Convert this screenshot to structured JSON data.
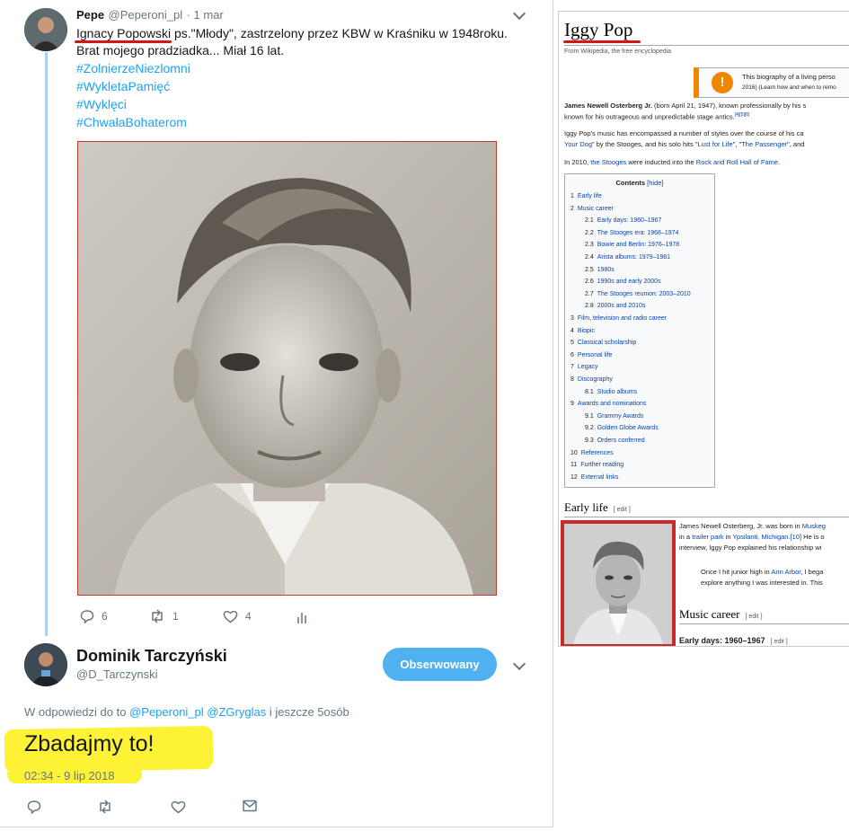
{
  "tweet1": {
    "author_name": "Pepe",
    "author_handle": "@Peperoni_pl",
    "date": "· 1 mar",
    "text_line1_name": "Ignacy Popowski",
    "text_line1_rest": " ps.\"Młody\", zastrzelony przez KBW w Kraśniku w 1948roku.",
    "text_line2": "Brat mojego pradziadka... Miał 16 lat.",
    "hashtags": [
      "#ZolnierzeNiezlomni",
      "#WykletaPamięć",
      "#Wyklęci",
      "#ChwałaBohaterom"
    ],
    "replies": "6",
    "retweets": "1",
    "likes": "4"
  },
  "tweet2": {
    "author_name": "Dominik Tarczyński",
    "author_handle": "@D_Tarczynski",
    "follow_label": "Obserwowany",
    "reply_prefix": "W odpowiedzi do to ",
    "mention1": "@Peperoni_pl",
    "mention2": "@ZGryglas",
    "reply_suffix": " i jeszcze 5osób",
    "text": "Zbadajmy to!",
    "timestamp": "02:34 - 9 lip 2018"
  },
  "wiki": {
    "title": "Iggy Pop",
    "from": "From Wikipedia, the free encyclopedia",
    "notice_line1": "This biography of a living perso",
    "notice_line2": "2016) (Learn how and when to remo",
    "lead1_bold": "James Newell Osterberg Jr.",
    "lead1_rest": " (born April 21, 1947), known professionally by his s",
    "lead2": "known for his outrageous and unpredictable stage antics.",
    "lead2_ref": "[4][5][6]",
    "para2_line1": "Iggy Pop's music has encompassed a number of styles over the course of his ca",
    "para2_line2_link1": "Your Dog",
    "para2_line2_mid": "\" by the Stooges, and his solo hits \"",
    "para2_line2_link2": "Lust for Life",
    "para2_line2_sep": "\", \"",
    "para2_line2_link3": "The Passenger",
    "para2_line2_end": "\", and",
    "para3_pre": "In 2010, ",
    "para3_link1": "the Stooges",
    "para3_mid": " were inducted into the ",
    "para3_link2": "Rock and Roll Hall of Fame",
    "para3_end": ".",
    "toc_title": "Contents",
    "toc_hide": "[hide]",
    "toc": [
      {
        "num": "1",
        "label": "Early life",
        "level": 1
      },
      {
        "num": "2",
        "label": "Music career",
        "level": 1
      },
      {
        "num": "2.1",
        "label": "Early days: 1960–1967",
        "level": 2
      },
      {
        "num": "2.2",
        "label": "The Stooges era: 1968–1974",
        "level": 2
      },
      {
        "num": "2.3",
        "label": "Bowie and Berlin: 1976–1978",
        "level": 2
      },
      {
        "num": "2.4",
        "label": "Arista albums: 1979–1981",
        "level": 2
      },
      {
        "num": "2.5",
        "label": "1980s",
        "level": 2
      },
      {
        "num": "2.6",
        "label": "1990s and early 2000s",
        "level": 2
      },
      {
        "num": "2.7",
        "label": "The Stooges reunion: 2003–2010",
        "level": 2
      },
      {
        "num": "2.8",
        "label": "2000s and 2010s",
        "level": 2
      },
      {
        "num": "3",
        "label": "Film, television and radio career",
        "level": 1
      },
      {
        "num": "4",
        "label": "Biopic",
        "level": 1
      },
      {
        "num": "5",
        "label": "Classical scholarship",
        "level": 1
      },
      {
        "num": "6",
        "label": "Personal life",
        "level": 1
      },
      {
        "num": "7",
        "label": "Legacy",
        "level": 1
      },
      {
        "num": "8",
        "label": "Discography",
        "level": 1
      },
      {
        "num": "8.1",
        "label": "Studio albums",
        "level": 2
      },
      {
        "num": "9",
        "label": "Awards and nominations",
        "level": 1
      },
      {
        "num": "9.1",
        "label": "Grammy Awards",
        "level": 2
      },
      {
        "num": "9.2",
        "label": "Golden Globe Awards",
        "level": 2
      },
      {
        "num": "9.3",
        "label": "Orders conferred",
        "level": 2
      },
      {
        "num": "10",
        "label": "References",
        "level": 1
      },
      {
        "num": "11",
        "label": "Further reading",
        "level": 1
      },
      {
        "num": "12",
        "label": "External links",
        "level": 1
      }
    ],
    "early_life_heading": "Early life",
    "edit_label": "[ edit ]",
    "early1_pre": "James Newell Osterberg, Jr. was born in ",
    "early1_link": "Muskeg",
    "early2_pre": "in a ",
    "early2_link1": "trailer park",
    "early2_mid": " in ",
    "early2_link2": "Ypsilanti, Michigan",
    "early2_ref": ".[10]",
    "early2_end": " He is o",
    "early3": "interview, Iggy Pop explained his relationship wi",
    "quote1_pre": "Once I hit junior high in ",
    "quote1_link": "Ann Arbor",
    "quote1_end": ", I bega",
    "quote2": "explore anything I was interested in. This",
    "music_heading": "Music career",
    "early_days_heading": "Early days: 1960–1967"
  }
}
